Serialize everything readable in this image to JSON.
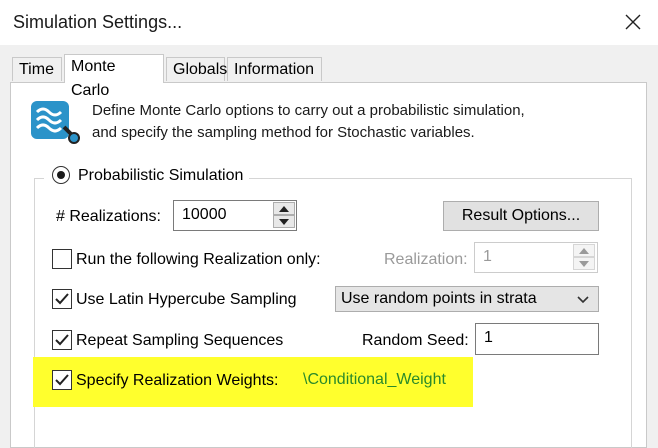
{
  "window": {
    "title": "Simulation Settings..."
  },
  "tabs": [
    {
      "label": "Time",
      "active": false
    },
    {
      "label": "Monte Carlo",
      "active": true
    },
    {
      "label": "Globals",
      "active": false
    },
    {
      "label": "Information",
      "active": false
    }
  ],
  "intro": {
    "icon": "monte-carlo-icon",
    "line1": "Define Monte Carlo options to carry out a probabilistic simulation,",
    "line2": "and specify the sampling method for Stochastic variables."
  },
  "simulation": {
    "mode_label": "Probabilistic Simulation",
    "realizations_label": "# Realizations:",
    "realizations_value": "10000",
    "result_options_label": "Result Options...",
    "run_following_label": "Run the following Realization only:",
    "run_following_checked": false,
    "realization_label": "Realization:",
    "realization_value": "1",
    "latin_label": "Use Latin Hypercube Sampling",
    "latin_checked": true,
    "sampling_method": "Use random points in strata",
    "repeat_label": "Repeat Sampling Sequences",
    "repeat_checked": true,
    "random_seed_label": "Random Seed:",
    "random_seed_value": "1",
    "weights_label": "Specify Realization Weights:",
    "weights_checked": true,
    "weights_value": "\\Conditional_Weight"
  },
  "colors": {
    "highlight": "#ffff2d",
    "weight_text": "#2a8a2a",
    "icon": "#2b93c9"
  }
}
